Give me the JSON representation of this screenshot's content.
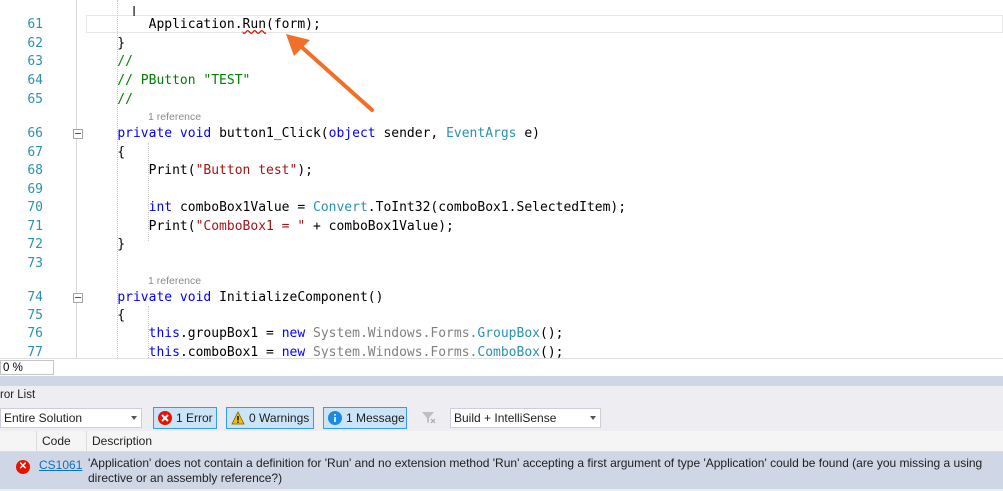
{
  "editor": {
    "lines": [
      {
        "num": "61",
        "tokens": [
          {
            "t": "        Application.",
            "c": "#000000"
          },
          {
            "t": "Run",
            "c": "#000000",
            "squiggle": true
          },
          {
            "t": "(form);",
            "c": "#000000"
          }
        ]
      },
      {
        "num": "62",
        "tokens": [
          {
            "t": "    }",
            "c": "#000000"
          }
        ]
      },
      {
        "num": "63",
        "tokens": [
          {
            "t": "    //",
            "c": "#008000"
          }
        ]
      },
      {
        "num": "64",
        "tokens": [
          {
            "t": "    // PButton \"TEST\"",
            "c": "#008000"
          }
        ]
      },
      {
        "num": "65",
        "tokens": [
          {
            "t": "    //",
            "c": "#008000"
          }
        ]
      },
      {
        "num": "66",
        "tokens": [
          {
            "t": "    ",
            "c": "#000"
          },
          {
            "t": "private void ",
            "c": "#0000ff"
          },
          {
            "t": "button1_Click(",
            "c": "#000"
          },
          {
            "t": "object ",
            "c": "#0000ff"
          },
          {
            "t": "sender, ",
            "c": "#000"
          },
          {
            "t": "EventArgs ",
            "c": "#2b91af"
          },
          {
            "t": "e)",
            "c": "#000"
          }
        ]
      },
      {
        "num": "67",
        "tokens": [
          {
            "t": "    {",
            "c": "#000000"
          }
        ]
      },
      {
        "num": "68",
        "tokens": [
          {
            "t": "        Print(",
            "c": "#000"
          },
          {
            "t": "\"Button test\"",
            "c": "#a31515"
          },
          {
            "t": ");",
            "c": "#000"
          }
        ]
      },
      {
        "num": "69",
        "tokens": []
      },
      {
        "num": "70",
        "tokens": [
          {
            "t": "        ",
            "c": "#000"
          },
          {
            "t": "int ",
            "c": "#0000ff"
          },
          {
            "t": "comboBox1Value = ",
            "c": "#000"
          },
          {
            "t": "Convert",
            "c": "#2b91af"
          },
          {
            "t": ".ToInt32(comboBox1.SelectedItem);",
            "c": "#000"
          }
        ]
      },
      {
        "num": "71",
        "tokens": [
          {
            "t": "        Print(",
            "c": "#000"
          },
          {
            "t": "\"ComboBox1 = \"",
            "c": "#a31515"
          },
          {
            "t": " + comboBox1Value);",
            "c": "#000"
          }
        ]
      },
      {
        "num": "72",
        "tokens": [
          {
            "t": "    }",
            "c": "#000000"
          }
        ]
      },
      {
        "num": "73",
        "tokens": []
      },
      {
        "num": "74",
        "tokens": [
          {
            "t": "    ",
            "c": "#000"
          },
          {
            "t": "private void ",
            "c": "#0000ff"
          },
          {
            "t": "InitializeComponent()",
            "c": "#000"
          }
        ]
      },
      {
        "num": "75",
        "tokens": [
          {
            "t": "    {",
            "c": "#000000"
          }
        ]
      },
      {
        "num": "76",
        "tokens": [
          {
            "t": "        ",
            "c": "#000"
          },
          {
            "t": "this",
            "c": "#0000ff"
          },
          {
            "t": ".groupBox1 = ",
            "c": "#000"
          },
          {
            "t": "new ",
            "c": "#0000ff"
          },
          {
            "t": "System.Windows.Forms.",
            "c": "#808080"
          },
          {
            "t": "GroupBox",
            "c": "#2b91af"
          },
          {
            "t": "();",
            "c": "#000"
          }
        ]
      },
      {
        "num": "77",
        "tokens": [
          {
            "t": "        ",
            "c": "#000"
          },
          {
            "t": "this",
            "c": "#0000ff"
          },
          {
            "t": ".comboBox1 = ",
            "c": "#000"
          },
          {
            "t": "new ",
            "c": "#0000ff"
          },
          {
            "t": "System.Windows.Forms.",
            "c": "#808080"
          },
          {
            "t": "ComboBox",
            "c": "#2b91af"
          },
          {
            "t": "();",
            "c": "#000"
          }
        ]
      }
    ],
    "codelens": [
      {
        "text": "1 reference"
      },
      {
        "text": "1 reference"
      }
    ]
  },
  "zoom": {
    "value": "0 %"
  },
  "error_list": {
    "title": "ror List",
    "scope": "Entire Solution",
    "errors_label": "1 Error",
    "warnings_label": "0 Warnings",
    "messages_label": "1 Message",
    "build_filter": "Build + IntelliSense",
    "columns": {
      "code": "Code",
      "description": "Description"
    },
    "rows": [
      {
        "code": "CS1061",
        "description": "'Application' does not contain a definition for 'Run' and no extension method 'Run' accepting a first argument of type 'Application' could be found (are you missing a using directive or an assembly reference?)"
      }
    ]
  },
  "colors": {
    "accent": "#3399ff",
    "error": "#e51400",
    "warning": "#f2c200",
    "info": "#1e88e5",
    "annotation_arrow": "#f07028"
  }
}
